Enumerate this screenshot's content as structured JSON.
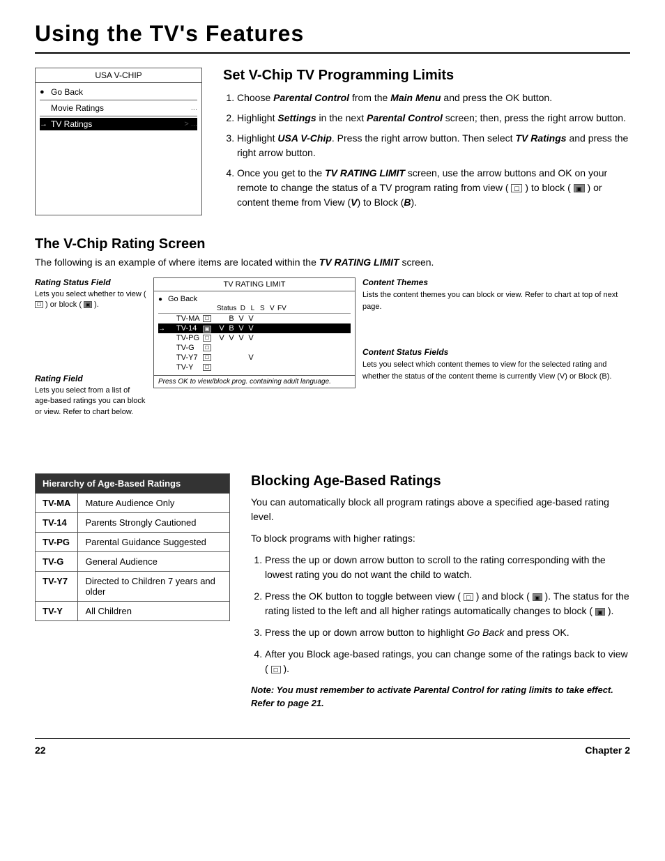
{
  "page": {
    "title": "Using the TV's Features",
    "footer_page": "22",
    "footer_chapter": "Chapter 2"
  },
  "vchip_menu": {
    "title": "USA V-CHIP",
    "items": [
      {
        "label": "Go Back",
        "has_circle": true,
        "selected": false,
        "dots": ""
      },
      {
        "label": "Movie Ratings",
        "selected": false,
        "dots": "..."
      },
      {
        "label": "TV Ratings",
        "selected": true,
        "dots": "> ..."
      }
    ]
  },
  "set_vchip": {
    "heading": "Set V-Chip TV Programming Limits",
    "steps": [
      "Choose Parental Control from the Main Menu and press the OK button.",
      "Highlight Settings in the next Parental Control screen; then, press the right arrow button.",
      "Highlight USA V-Chip. Press the right arrow button. Then select TV Ratings and press the right arrow button.",
      "Once you get to the TV RATING LIMIT screen, use the arrow buttons and OK on your remote to change the status of a TV program rating from view ( ☐ ) to block ( ▣ ) or content theme from View (V) to Block (B)."
    ]
  },
  "vchip_rating_screen": {
    "heading": "The V-Chip Rating Screen",
    "subtitle": "The following is an example of where items are located within the TV RATING LIMIT screen.",
    "rating_status_field": {
      "title": "Rating Status Field",
      "body": "Lets you select whether to view ( ☐ ) or block ( ▣ )."
    },
    "rating_field": {
      "title": "Rating Field",
      "body": "Lets you select from a list of age-based ratings you can block or view. Refer to chart below."
    },
    "content_themes": {
      "title": "Content Themes",
      "body": "Lists the content themes you can block or view. Refer to chart at top of next page."
    },
    "content_status_fields": {
      "title": "Content Status Fields",
      "body": "Lets you select which content themes to view for the selected rating and whether the status of the content theme is currently View (V) or Block (B)."
    },
    "tv_rating_box": {
      "title": "TV RATING LIMIT",
      "go_back": "Go Back",
      "header_cols": [
        "Status",
        "D",
        "L",
        "S",
        "V",
        "FV"
      ],
      "rows": [
        {
          "label": "TV-MA",
          "status": "☐",
          "cols": [
            "",
            "B",
            "V",
            "V"
          ],
          "selected": false
        },
        {
          "label": "TV-14",
          "status": "▣",
          "cols": [
            "V",
            "B",
            "V",
            "V"
          ],
          "selected": true
        },
        {
          "label": "TV-PG",
          "status": "☐",
          "cols": [
            "V",
            "V",
            "V",
            "V"
          ],
          "selected": false
        },
        {
          "label": "TV-G",
          "status": "☐",
          "cols": [
            "",
            "",
            "",
            ""
          ],
          "selected": false
        },
        {
          "label": "TV-Y7",
          "status": "☐",
          "cols": [
            "",
            "",
            "",
            "V"
          ],
          "selected": false
        },
        {
          "label": "TV-Y",
          "status": "☐",
          "cols": [
            "",
            "",
            "",
            ""
          ],
          "selected": false
        }
      ],
      "footer": "Press OK to view/block prog. containing adult language."
    }
  },
  "age_ratings_table": {
    "heading": "Hierarchy of Age-Based Ratings",
    "rows": [
      {
        "rating": "TV-MA",
        "description": "Mature Audience Only"
      },
      {
        "rating": "TV-14",
        "description": "Parents Strongly Cautioned"
      },
      {
        "rating": "TV-PG",
        "description": "Parental Guidance Suggested"
      },
      {
        "rating": "TV-G",
        "description": "General Audience"
      },
      {
        "rating": "TV-Y7",
        "description": "Directed to Children 7 years and older"
      },
      {
        "rating": "TV-Y",
        "description": "All Children"
      }
    ]
  },
  "blocking_section": {
    "heading": "Blocking Age-Based Ratings",
    "intro1": "You can automatically block all program ratings above a specified age-based rating level.",
    "intro2": "To block programs with higher ratings:",
    "steps": [
      "Press the up or down arrow button to scroll to the rating corresponding with the lowest rating you do not want the child to watch.",
      "Press the OK button to toggle between view ( ☐ ) and block ( ▣ ). The status for the rating listed to the left and all higher ratings automatically changes to block ( ▣ ).",
      "Press the up or down arrow button to highlight Go Back and press OK.",
      "After you Block age-based ratings, you can change some of the ratings back to view ( ☐ )."
    ],
    "note": "Note: You must remember to activate Parental Control for rating limits to take effect. Refer to page 21."
  }
}
